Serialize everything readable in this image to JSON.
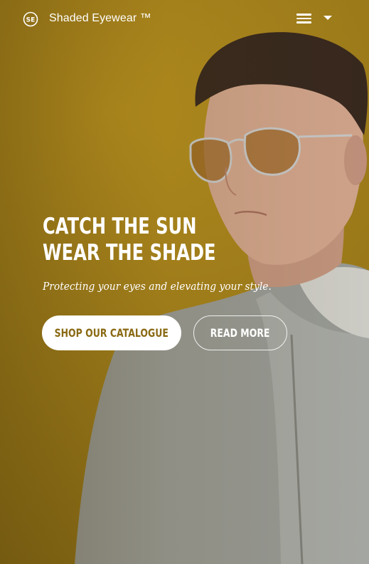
{
  "header": {
    "brand": "Shaded Eyewear ™",
    "logo_icon": "se-monogram-logo",
    "menu_icon": "hamburger-menu-icon",
    "dropdown_icon": "caret-down-icon"
  },
  "hero": {
    "headline_line1": "CATCH THE SUN",
    "headline_line2": "WEAR THE SHADE",
    "tagline": "Protecting your eyes and elevating your style.",
    "primary_button": "SHOP OUR CATALOGUE",
    "secondary_button": "READ MORE"
  },
  "colors": {
    "background": "#b08d20",
    "accent_text": "#8a6a14",
    "text": "#ffffff"
  }
}
